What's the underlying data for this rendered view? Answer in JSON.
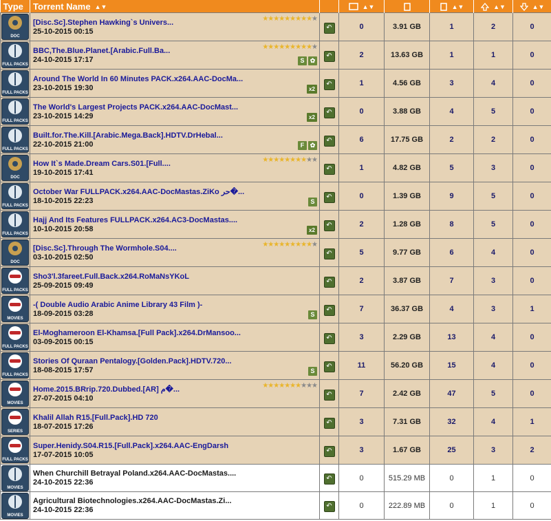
{
  "header": {
    "type": "Type",
    "name": "Torrent Name"
  },
  "colors": {
    "header": "#f08a1e",
    "row": "#e6d3b6",
    "title": "#1a1a9a",
    "star": "#e9b52c",
    "tag": "#6a8a3a"
  },
  "rows": [
    {
      "category": "DOC",
      "icon": "doc-reel-icon",
      "title": "[Disc.Sc].Stephen Hawking`s Univers...",
      "date": "25-10-2015 00:15",
      "stars": 9,
      "tags": [],
      "comments": "0",
      "size": "3.91 GB",
      "files": "1",
      "seeders": "2",
      "leechers": "0",
      "style": "r"
    },
    {
      "category": "FULL PACKS",
      "icon": "globe-icon",
      "title": "BBC,The.Blue.Planet.[Arabic.Full.Ba...",
      "date": "24-10-2015 17:17",
      "stars": 9,
      "tags": [
        "S",
        "✿"
      ],
      "comments": "2",
      "size": "13.63 GB",
      "files": "1",
      "seeders": "1",
      "leechers": "0",
      "style": "r"
    },
    {
      "category": "FULL PACKS",
      "icon": "globe-icon",
      "title": "Around The World In 60 Minutes PACK.x264.AAC-DocMa...",
      "date": "23-10-2015 19:30",
      "stars": 0,
      "tags": [
        "x2"
      ],
      "comments": "1",
      "size": "4.56 GB",
      "files": "3",
      "seeders": "4",
      "leechers": "0",
      "style": "r"
    },
    {
      "category": "FULL PACKS",
      "icon": "globe-icon",
      "title": "The World's Largest Projects PACK.x264.AAC-DocMast...",
      "date": "23-10-2015 14:29",
      "stars": 0,
      "tags": [
        "x2"
      ],
      "comments": "0",
      "size": "3.88 GB",
      "files": "4",
      "seeders": "5",
      "leechers": "0",
      "style": "r"
    },
    {
      "category": "FULL PACKS",
      "icon": "globe-icon",
      "title": "Built.for.The.Kill.[Arabic.Mega.Back].HDTV.DrHebal...",
      "date": "22-10-2015 21:00",
      "stars": 0,
      "tags": [
        "F",
        "✿"
      ],
      "comments": "6",
      "size": "17.75 GB",
      "files": "2",
      "seeders": "2",
      "leechers": "0",
      "style": "r"
    },
    {
      "category": "DOC",
      "icon": "doc-reel-icon",
      "title": "How It`s Made.Dream Cars.S01.[Full....",
      "date": "19-10-2015 17:41",
      "stars": 8,
      "tags": [],
      "comments": "1",
      "size": "4.82 GB",
      "files": "5",
      "seeders": "3",
      "leechers": "0",
      "style": "r"
    },
    {
      "category": "FULL PACKS",
      "icon": "globe-icon",
      "title": "October War FULLPACK.x264.AAC-DocMastas.ZiKo حر�...",
      "date": "18-10-2015 22:23",
      "stars": 0,
      "tags": [
        "S"
      ],
      "comments": "0",
      "size": "1.39 GB",
      "files": "9",
      "seeders": "5",
      "leechers": "0",
      "style": "r"
    },
    {
      "category": "FULL PACKS",
      "icon": "globe-icon",
      "title": "Hajj And Its Features FULLPACK.x264.AC3-DocMastas....",
      "date": "10-10-2015 20:58",
      "stars": 0,
      "tags": [
        "x2"
      ],
      "comments": "2",
      "size": "1.28 GB",
      "files": "8",
      "seeders": "5",
      "leechers": "0",
      "style": "r"
    },
    {
      "category": "DOC",
      "icon": "doc-reel-icon",
      "title": "[Disc.Sc].Through The Wormhole.S04....",
      "date": "03-10-2015 02:50",
      "stars": 9,
      "tags": [],
      "comments": "5",
      "size": "9.77 GB",
      "files": "6",
      "seeders": "4",
      "leechers": "0",
      "style": "r"
    },
    {
      "category": "FULL PACKS",
      "icon": "glasses-icon",
      "title": "Sho3'l.3fareet.Full.Back.x264.RoMaNsYKoL",
      "date": "25-09-2015 09:49",
      "stars": 0,
      "tags": [],
      "comments": "2",
      "size": "3.87 GB",
      "files": "7",
      "seeders": "3",
      "leechers": "0",
      "style": "r"
    },
    {
      "category": "MOVIES",
      "icon": "glasses-icon",
      "title": "-( Double Audio Arabic Anime Library 43 Film )-",
      "date": "18-09-2015 03:28",
      "stars": 0,
      "tags": [
        "S"
      ],
      "comments": "7",
      "size": "36.37 GB",
      "files": "4",
      "seeders": "3",
      "leechers": "1",
      "style": "r"
    },
    {
      "category": "FULL PACKS",
      "icon": "glasses-icon",
      "title": "El-Moghameroon El-Khamsa.[Full Pack].x264.DrMansoo...",
      "date": "03-09-2015 00:15",
      "stars": 0,
      "tags": [],
      "comments": "3",
      "size": "2.29 GB",
      "files": "13",
      "seeders": "4",
      "leechers": "0",
      "style": "r"
    },
    {
      "category": "FULL PACKS",
      "icon": "glasses-icon",
      "title": "Stories Of Quraan Pentalogy.[Golden.Pack].HDTV.720...",
      "date": "18-08-2015 17:57",
      "stars": 0,
      "tags": [
        "S"
      ],
      "comments": "11",
      "size": "56.20 GB",
      "files": "15",
      "seeders": "4",
      "leechers": "0",
      "style": "r"
    },
    {
      "category": "MOVIES",
      "icon": "glasses-icon",
      "title": "Home.2015.BRrip.720.Dubbed.[AR] م�...",
      "date": "27-07-2015 04:10",
      "stars": 7,
      "tags": [],
      "comments": "7",
      "size": "2.42 GB",
      "files": "47",
      "seeders": "5",
      "leechers": "0",
      "style": "r"
    },
    {
      "category": "SERIES",
      "icon": "glasses-icon",
      "title": "Khalil Allah R15.[Full.Pack].HD 720",
      "date": "18-07-2015 17:26",
      "stars": 0,
      "tags": [],
      "comments": "3",
      "size": "7.31 GB",
      "files": "32",
      "seeders": "4",
      "leechers": "1",
      "style": "r"
    },
    {
      "category": "FULL PACKS",
      "icon": "glasses-icon",
      "title": "Super.Henidy.S04.R15.[Full.Pack].x264.AAC-EngDarsh",
      "date": "17-07-2015 10:05",
      "stars": 0,
      "tags": [],
      "comments": "3",
      "size": "1.67 GB",
      "files": "25",
      "seeders": "3",
      "leechers": "2",
      "style": "r"
    },
    {
      "category": "MOVIES",
      "icon": "globe-icon",
      "title": "When Churchill Betrayal Poland.x264.AAC-DocMastas....",
      "date": "24-10-2015 22:36",
      "stars": 0,
      "tags": [],
      "comments": "0",
      "size": "515.29 MB",
      "files": "0",
      "seeders": "1",
      "leechers": "0",
      "style": "w"
    },
    {
      "category": "MOVIES",
      "icon": "globe-icon",
      "title": "Agricultural Biotechnologies.x264.AAC-DocMastas.Zi...",
      "date": "24-10-2015 22:36",
      "stars": 0,
      "tags": [],
      "comments": "0",
      "size": "222.89 MB",
      "files": "0",
      "seeders": "1",
      "leechers": "0",
      "style": "w"
    }
  ]
}
